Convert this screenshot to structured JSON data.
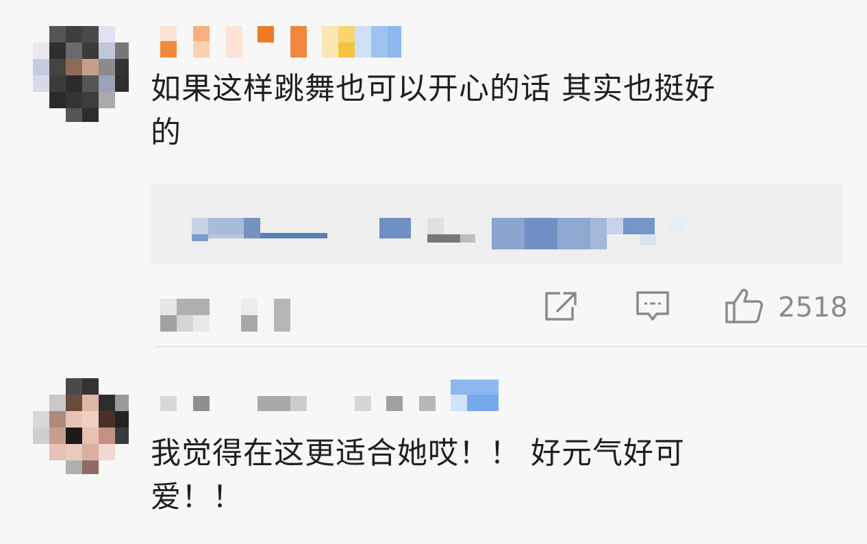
{
  "comments": [
    {
      "text_line1": "如果这样跳舞也可以开心的话 其实也挺好",
      "text_line2": "的"
    },
    {
      "text_line1": "我觉得在这更适合她哎！！ 好元气好可",
      "text_line2": "爱！！"
    }
  ],
  "actions": {
    "share_icon": "share-icon",
    "comment_icon": "comment-icon",
    "like_icon": "thumbs-up-icon",
    "like_count": "2518"
  },
  "colors": {
    "background": "#f7f7f7",
    "quote_background": "#efefef",
    "icon_gray": "#8a8a8a"
  }
}
